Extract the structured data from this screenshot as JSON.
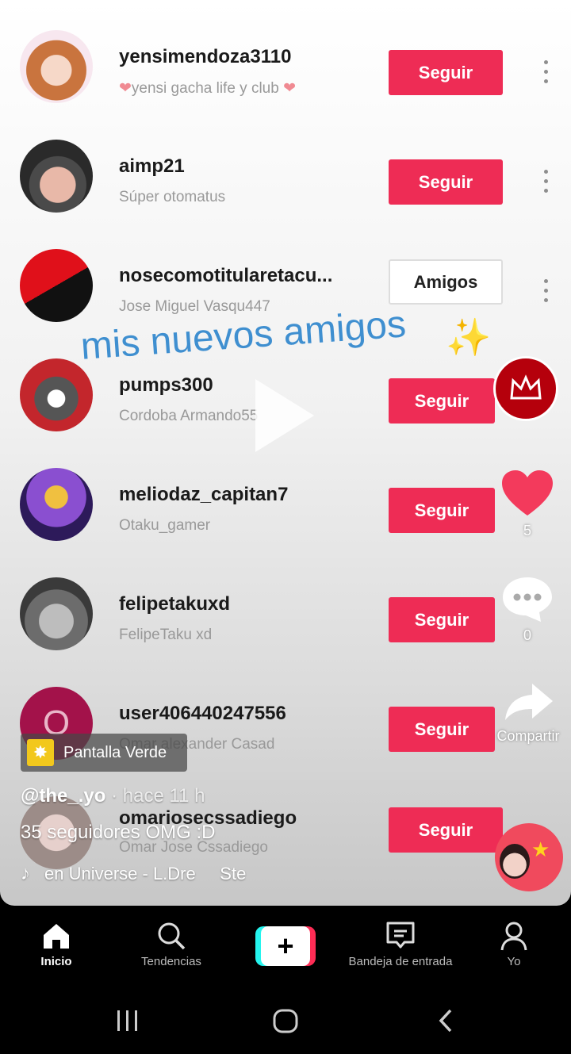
{
  "users": [
    {
      "username": "yensimendoza3110",
      "subtitle": "yensi gacha life y club",
      "button": "Seguir"
    },
    {
      "username": "aimp21",
      "subtitle": "Súper otomatus",
      "button": "Seguir"
    },
    {
      "username": "nosecomotitularetacu...",
      "subtitle": "Jose Miguel Vasqu447",
      "button": "Amigos"
    },
    {
      "username": "pumps300",
      "subtitle": "Cordoba Armando55",
      "button": "Seguir"
    },
    {
      "username": "meliodaz_capitan7",
      "subtitle": "Otaku_gamer",
      "button": "Seguir"
    },
    {
      "username": "felipetakuxd",
      "subtitle": "FelipeTaku xd",
      "button": "Seguir"
    },
    {
      "username": "user406440247556",
      "subtitle": "Omar alexander Casad",
      "button": "Seguir",
      "avatar_letter": "O"
    },
    {
      "username": "omariosecssadiego",
      "subtitle": "Omar Jose Cssadiego",
      "button": "Seguir"
    }
  ],
  "overlay_text": "mis nuevos amigos",
  "likes": "5",
  "comments": "0",
  "share_label": "Compartir",
  "effect_label": "Pantalla Verde",
  "author": "@the_.yo",
  "time_ago": "· hace 11 h",
  "description": "35 seguidores OMG :D",
  "music": "en Universe - L.Dre     Ste",
  "nav": {
    "home": "Inicio",
    "discover": "Tendencias",
    "inbox": "Bandeja de entrada",
    "me": "Yo"
  },
  "colors": {
    "accent": "#ee2c55",
    "overlay_text": "#3f8fd0"
  }
}
